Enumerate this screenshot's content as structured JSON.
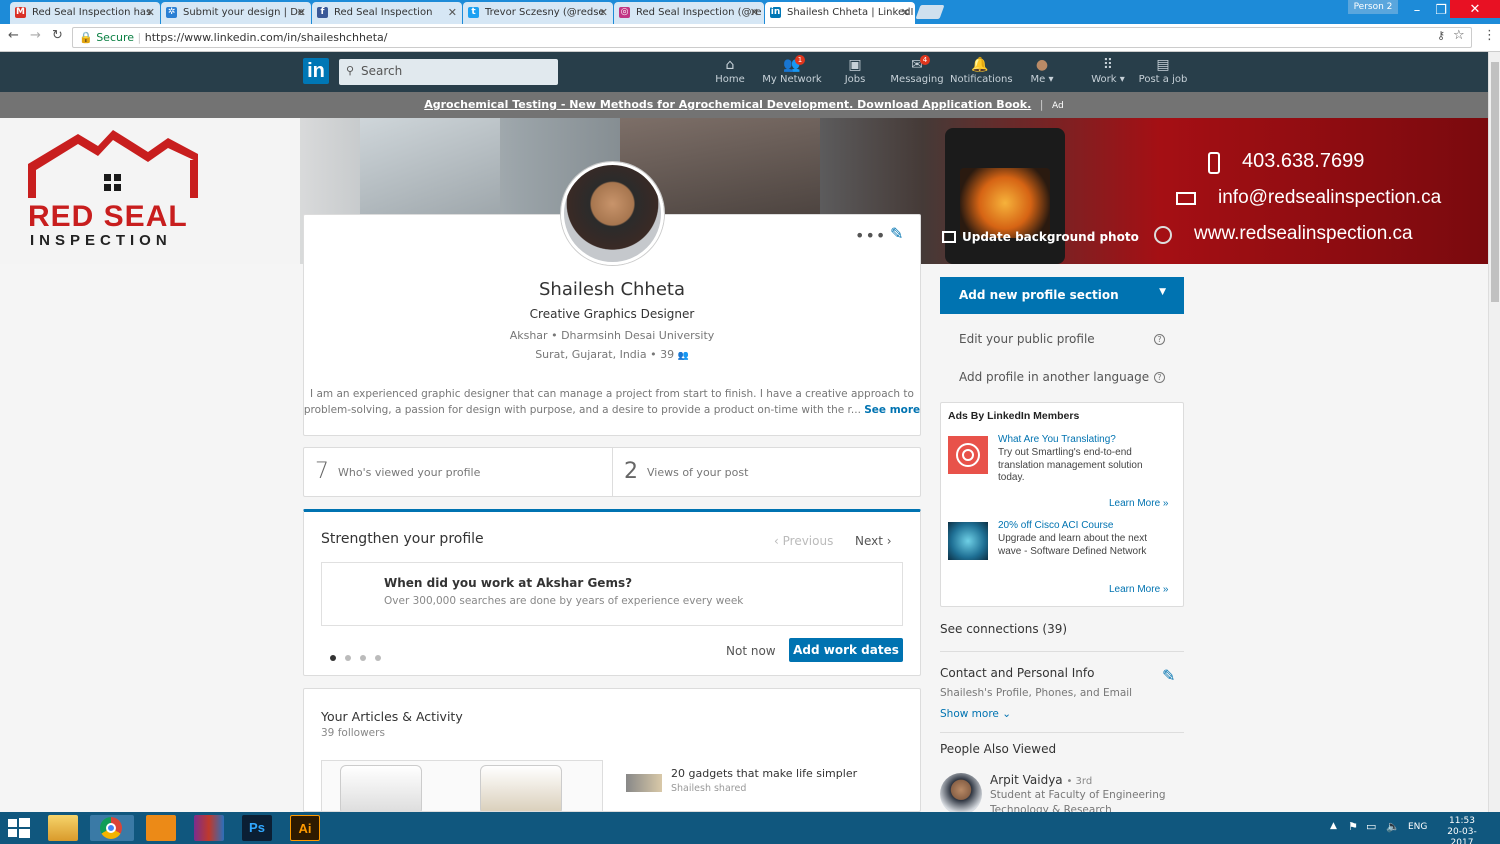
{
  "browser": {
    "tabs": [
      {
        "label": "Red Seal Inspection has",
        "icon": "gmail-icon",
        "color": "#d93025",
        "glyph": "M"
      },
      {
        "label": "Submit your design | De",
        "icon": "gear-icon",
        "color": "#2a7fd4",
        "glyph": "✲"
      },
      {
        "label": "Red Seal Inspection",
        "icon": "facebook-icon",
        "color": "#3b5998",
        "glyph": "f"
      },
      {
        "label": "Trevor Sczesny (@redse",
        "icon": "twitter-icon",
        "color": "#1da1f2",
        "glyph": "t"
      },
      {
        "label": "Red Seal Inspection (@re",
        "icon": "instagram-icon",
        "color": "#c13584",
        "glyph": "◎"
      },
      {
        "label": "Shailesh Chheta | LinkedI",
        "icon": "linkedin-icon",
        "color": "#0077b5",
        "glyph": "in"
      }
    ],
    "person": "Person 2",
    "secure_label": "Secure",
    "url": "https://www.linkedin.com/in/shaileshchheta/"
  },
  "nav": {
    "search_placeholder": "Search",
    "items": [
      {
        "label": "Home",
        "icon": "home-icon",
        "badge": ""
      },
      {
        "label": "My Network",
        "icon": "network-icon",
        "badge": "1"
      },
      {
        "label": "Jobs",
        "icon": "briefcase-icon",
        "badge": ""
      },
      {
        "label": "Messaging",
        "icon": "message-icon",
        "badge": "4"
      },
      {
        "label": "Notifications",
        "icon": "bell-icon",
        "badge": ""
      },
      {
        "label": "Me",
        "icon": "avatar-icon",
        "badge": ""
      },
      {
        "label": "Work",
        "icon": "grid-icon",
        "badge": ""
      },
      {
        "label": "Post a job",
        "icon": "post-job-icon",
        "badge": ""
      }
    ]
  },
  "ad": {
    "text": "Agrochemical Testing - New Methods for Agrochemical Development. Download Application Book.",
    "tag": "Ad"
  },
  "banner": {
    "logo_line1": "RED SEAL",
    "logo_line2": "INSPECTION",
    "phone": "403.638.7699",
    "email": "info@redsealinspection.ca",
    "website": "www.redsealinspection.ca",
    "update_label": "Update background photo"
  },
  "profile": {
    "name": "Shailesh Chheta",
    "headline": "Creative Graphics Designer",
    "company": "Akshar",
    "school": "Dharmsinh Desai University",
    "location": "Surat, Gujarat, India",
    "connections": "39",
    "summary_line1": "I am an experienced graphic designer that can manage a project from start to finish. I have a creative approach to",
    "summary_line2": "problem-solving, a passion for design with purpose, and a desire to provide a product on-time with the r...",
    "see_more": "See more"
  },
  "stats": {
    "views_count": "7",
    "views_label": "Who's viewed your profile",
    "post_count": "2",
    "post_label": "Views of your post"
  },
  "strengthen": {
    "title": "Strengthen your profile",
    "prev": "Previous",
    "next": "Next",
    "question": "When did you work at Akshar Gems?",
    "sub": "Over 300,000 searches are done by years of experience every week",
    "not_now": "Not now",
    "add_dates": "Add work dates"
  },
  "articles": {
    "title": "Your Articles & Activity",
    "followers": "39 followers",
    "item_title": "20 gadgets that make life simpler",
    "item_sub": "Shailesh shared"
  },
  "sidebar": {
    "add_section": "Add new profile section",
    "edit_public": "Edit your public profile",
    "add_language": "Add profile in another language",
    "ads_title": "Ads By LinkedIn Members",
    "ad1_title": "What Are You Translating?",
    "ad1_body": "Try out Smartling's end-to-end translation management solution today.",
    "ad2_title": "20% off Cisco ACI Course",
    "ad2_body": "Upgrade and learn about the next wave - Software Defined Network",
    "learn_more": "Learn More »",
    "see_connections": "See connections (39)",
    "contact_title": "Contact and Personal Info",
    "contact_sub": "Shailesh's Profile, Phones, and Email",
    "show_more": "Show more",
    "people_title": "People Also Viewed",
    "person_name": "Arpit Vaidya",
    "person_degree": "• 3rd",
    "person_sub1": "Student at Faculty of Engineering",
    "person_sub2": "Technology & Research"
  },
  "taskbar": {
    "lang": "ENG",
    "time": "11:53",
    "date": "20-03-2017"
  }
}
